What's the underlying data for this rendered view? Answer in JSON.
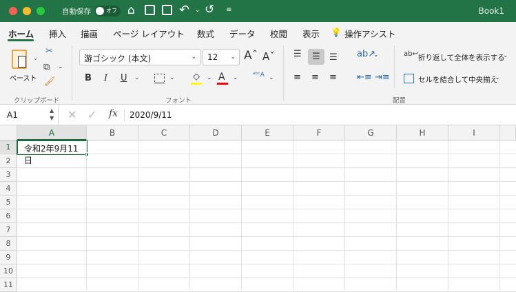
{
  "titlebar": {
    "autosave_label": "自動保存",
    "autosave_state": "オフ",
    "document_title": "Book1",
    "accent": "#227446"
  },
  "tabs": [
    {
      "label": "ホーム",
      "active": true
    },
    {
      "label": "挿入"
    },
    {
      "label": "描画"
    },
    {
      "label": "ページ レイアウト"
    },
    {
      "label": "数式"
    },
    {
      "label": "データ"
    },
    {
      "label": "校閲"
    },
    {
      "label": "表示"
    },
    {
      "label": "操作アシスト"
    }
  ],
  "ribbon": {
    "clipboard": {
      "paste_label": "ペースト",
      "group_label": "クリップボード"
    },
    "font": {
      "font_name": "游ゴシック (本文)",
      "font_size": "12",
      "group_label": "フォント",
      "bold": "B",
      "italic": "I",
      "underline": "U",
      "fill_color": "#ffff00",
      "font_color": "#ff0000"
    },
    "alignment": {
      "wrap_text": "折り返して全体を表示する",
      "merge_center": "セルを結合して中央揃え",
      "group_label": "配置"
    }
  },
  "formula_bar": {
    "name_box": "A1",
    "fx": "fx",
    "value": "2020/9/11"
  },
  "sheet": {
    "columns": [
      "A",
      "B",
      "C",
      "D",
      "E",
      "F",
      "G",
      "H",
      "I"
    ],
    "rows": [
      "1",
      "2",
      "3",
      "4",
      "5",
      "6",
      "7",
      "8",
      "9",
      "10",
      "11"
    ],
    "selected_cell": "A1",
    "cells": {
      "A1": "令和2年9月11日"
    }
  }
}
